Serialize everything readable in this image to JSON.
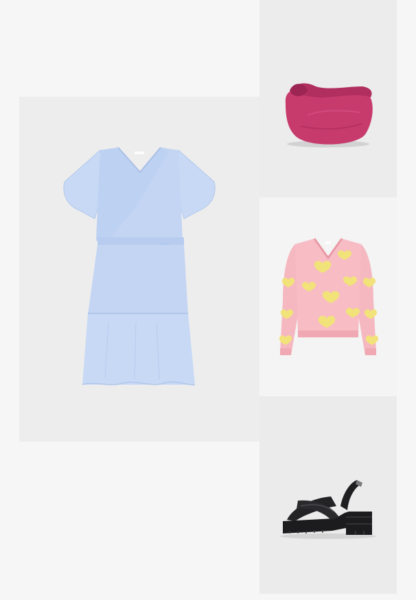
{
  "collage": {
    "items": [
      {
        "id": "dress",
        "kind": "dress",
        "color": "light-blue",
        "hex": "#c3d5f3",
        "icon": "dress-image"
      },
      {
        "id": "bag",
        "kind": "handbag",
        "color": "magenta",
        "hex": "#c73a6c",
        "icon": "bag-image"
      },
      {
        "id": "sweater",
        "kind": "sweater",
        "color": "pink-with-yellow-hearts",
        "hex": "#f5b8c0",
        "accent": "#f2e27a",
        "icon": "sweater-image"
      },
      {
        "id": "sandal",
        "kind": "sandal",
        "color": "black",
        "hex": "#1c1c1e",
        "icon": "sandal-image"
      }
    ]
  }
}
